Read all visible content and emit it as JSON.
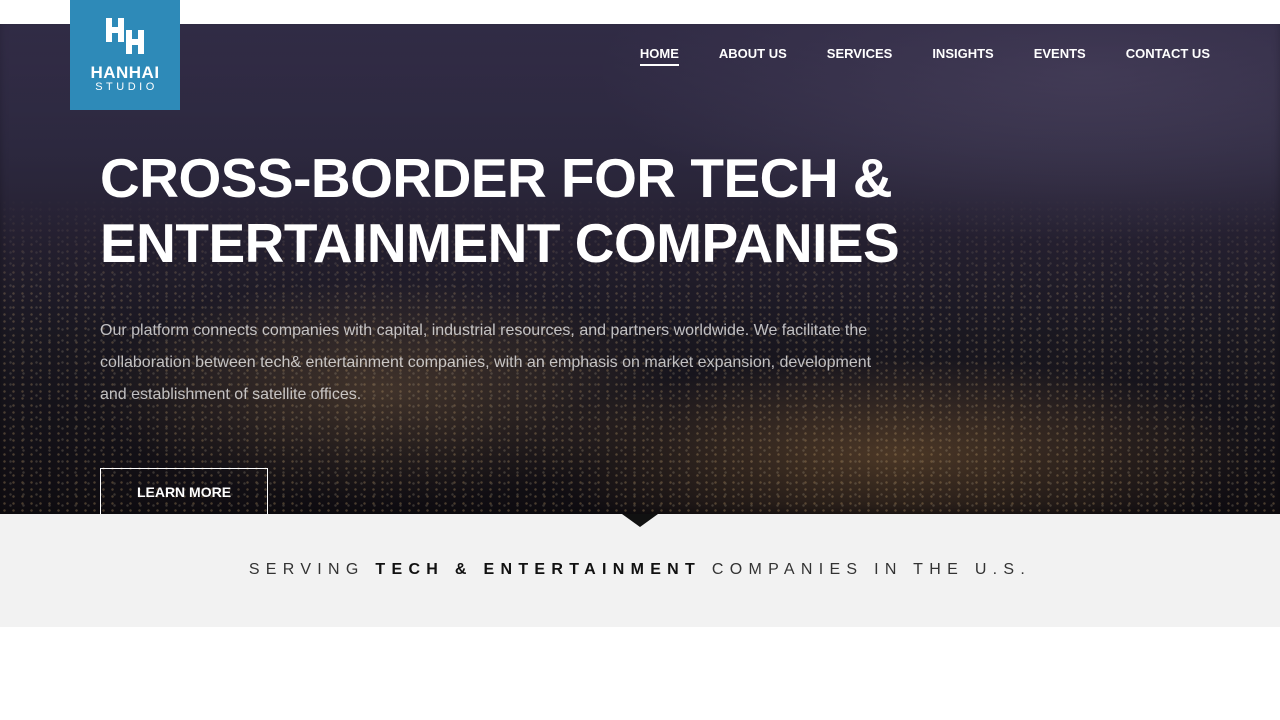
{
  "brand": {
    "name": "HANHAI",
    "subtitle": "STUDIO",
    "color": "#2e8ab8"
  },
  "nav": {
    "items": [
      {
        "label": "HOME",
        "active": true
      },
      {
        "label": "ABOUT US",
        "active": false
      },
      {
        "label": "SERVICES",
        "active": false
      },
      {
        "label": "INSIGHTS",
        "active": false
      },
      {
        "label": "EVENTS",
        "active": false
      },
      {
        "label": "CONTACT US",
        "active": false
      }
    ]
  },
  "hero": {
    "headline_line1": "CROSS-BORDER FOR TECH &",
    "headline_line2": "ENTERTAINMENT COMPANIES",
    "intro": "Our platform connects companies with capital, industrial resources, and partners worldwide. We facilitate the collaboration between tech& entertainment companies, with an emphasis on market expansion, development and establishment of satellite offices.",
    "cta_label": "LEARN MORE"
  },
  "tagline": {
    "prefix": "SERVING ",
    "emphasis": "TECH & ENTERTAINMENT",
    "suffix": " COMPANIES IN THE U.S."
  },
  "colors": {
    "band_background": "#f2f2f2",
    "notch": "#111111"
  }
}
